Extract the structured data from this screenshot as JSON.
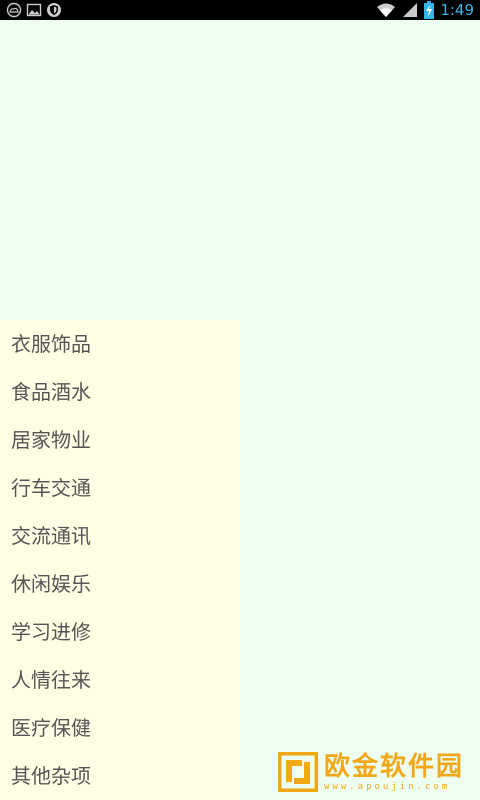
{
  "status_bar": {
    "time": "1:49",
    "left_icons": [
      "cloud-icon",
      "image-icon",
      "shield-icon"
    ],
    "right_icons": [
      "wifi-icon",
      "signal-icon",
      "battery-charging-icon"
    ],
    "accent_color": "#33b5e5"
  },
  "categories": [
    {
      "label": "衣服饰品"
    },
    {
      "label": "食品酒水"
    },
    {
      "label": "居家物业"
    },
    {
      "label": "行车交通"
    },
    {
      "label": "交流通讯"
    },
    {
      "label": "休闲娱乐"
    },
    {
      "label": "学习进修"
    },
    {
      "label": "人情往来"
    },
    {
      "label": "医疗保健"
    },
    {
      "label": "其他杂项"
    }
  ],
  "watermark": {
    "title": "欧金软件园",
    "subtitle": "www.apoujin.com",
    "color": "#f0a818"
  },
  "colors": {
    "background": "#edfdef",
    "panel": "#fffee5",
    "text": "#555555"
  }
}
